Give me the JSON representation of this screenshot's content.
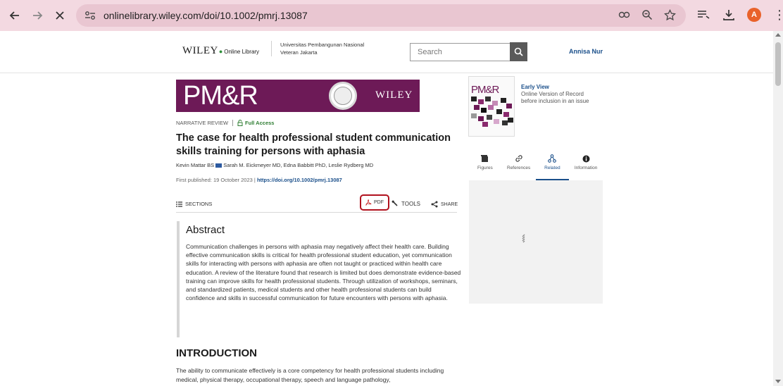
{
  "browser": {
    "url": "onlinelibrary.wiley.com/doi/10.1002/pmrj.13087",
    "avatar_letter": "A",
    "avatar_color": "#e9622a",
    "chrome_color": "#f3d9e1"
  },
  "header": {
    "logo_main": "WILEY",
    "logo_sub": "Online Library",
    "institution_line1": "Universitas Pembangunan Nasional",
    "institution_line2": "Veteran Jakarta",
    "search_placeholder": "Search",
    "user_name": "Annisa Nur"
  },
  "banner": {
    "journal": "PM&R",
    "publisher": "WILEY",
    "color": "#6d1a57"
  },
  "article": {
    "type": "NARRATIVE REVIEW",
    "access": "Full Access",
    "title": "The case for health professional student communication skills training for persons with aphasia",
    "authors_first": "Kevin Mattar BS",
    "authors_rest": "Sarah M. Eickmeyer MD, Edna Babbitt PhD, Leslie Rydberg MD",
    "published_label": "First published: 19 October 2023",
    "doi": "https://doi.org/10.1002/pmrj.13087"
  },
  "toolbar": {
    "sections": "SECTIONS",
    "pdf": "PDF",
    "tools": "TOOLS",
    "share": "SHARE"
  },
  "abstract": {
    "heading": "Abstract",
    "text": "Communication challenges in persons with aphasia may negatively affect their health care. Building effective communication skills is critical for health professional student education, yet communication skills for interacting with persons with aphasia are often not taught or practiced within health care education. A review of the literature found that research is limited but does demonstrate evidence-based training can improve skills for health professional students. Through utilization of workshops, seminars, and standardized patients, medical students and other health professional students can build confidence and skills in successful communication for future encounters with persons with aphasia."
  },
  "introduction": {
    "heading": "INTRODUCTION",
    "text": "The ability to communicate effectively is a core competency for health professional students including medical, physical therapy, occupational therapy, speech and language pathology,"
  },
  "sidebar": {
    "cover_title": "PM&R",
    "early_view": "Early View",
    "early_desc1": "Online Version of Record",
    "early_desc2": "before inclusion in an issue",
    "tabs": [
      {
        "label": "Figures"
      },
      {
        "label": "References"
      },
      {
        "label": "Related"
      },
      {
        "label": "Information"
      }
    ],
    "active_tab": "Related"
  }
}
